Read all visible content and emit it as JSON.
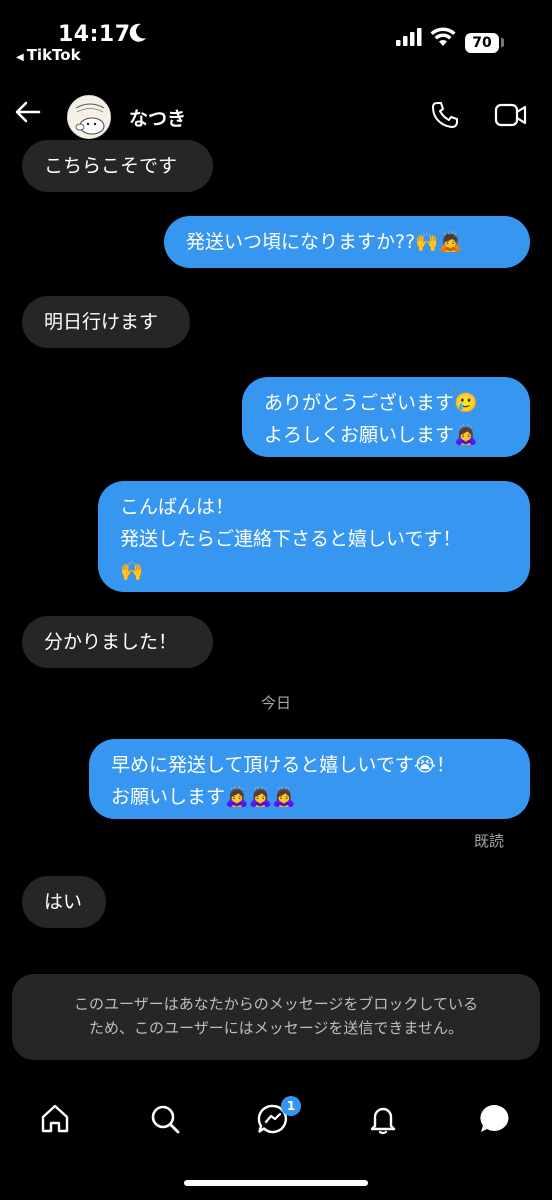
{
  "status_bar": {
    "time": "14:17",
    "back_app": "TikTok",
    "battery": "70"
  },
  "header": {
    "contact_name": "なつき"
  },
  "messages": [
    {
      "direction": "incoming",
      "text": "こちらこそです"
    },
    {
      "direction": "outgoing",
      "text": "発送いつ頃になりますか??🙌🙇"
    },
    {
      "direction": "incoming",
      "text": "明日行けます"
    },
    {
      "direction": "outgoing",
      "text": "ありがとうございます🥲\nよろしくお願いします🙇‍♀️"
    },
    {
      "direction": "outgoing",
      "text": "こんばんは！\n発送したらご連絡下さると嬉しいです！\n🙌"
    },
    {
      "direction": "incoming",
      "text": "分かりました！"
    },
    {
      "direction": "outgoing",
      "text": "早めに発送して頂けると嬉しいです😭！\nお願いします🙇‍♀️🙇‍♀️🙇‍♀️"
    },
    {
      "direction": "incoming",
      "text": "はい"
    }
  ],
  "date_separator": "今日",
  "seen_label": "既読",
  "blocked_notice": "このユーザーはあなたからのメッセージをブロックしている\nため、このユーザーにはメッセージを送信できません。",
  "nav": {
    "messages_badge": "1"
  },
  "colors": {
    "background": "#000000",
    "incoming_bubble": "#262626",
    "outgoing_bubble": "#3797f0"
  }
}
